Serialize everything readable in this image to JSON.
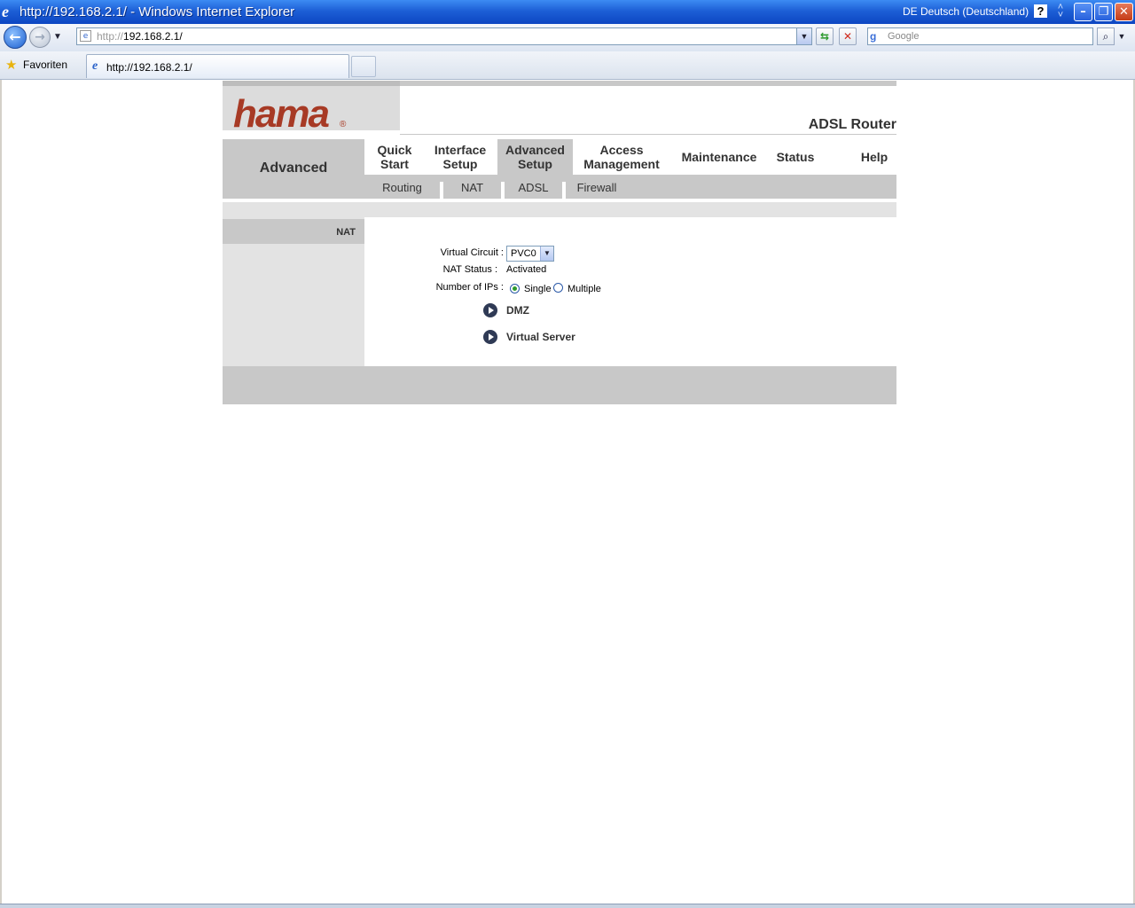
{
  "window": {
    "title": "http://192.168.2.1/ - Windows Internet Explorer",
    "language": "DE Deutsch (Deutschland)",
    "help": "?",
    "minimize": "–",
    "restore": "❐",
    "close": "✕"
  },
  "navigation": {
    "address_prefix": "http://",
    "address_host": "192.168.2.1/",
    "search_placeholder": "Google"
  },
  "favorites": {
    "label": "Favoriten",
    "tab_title": "http://192.168.2.1/"
  },
  "router": {
    "logo": "hama",
    "logo_mark": "®",
    "product": "ADSL Router",
    "section": "Advanced",
    "main_nav": [
      {
        "line1": "Quick",
        "line2": "Start"
      },
      {
        "line1": "Interface",
        "line2": "Setup"
      },
      {
        "line1": "Advanced",
        "line2": "Setup"
      },
      {
        "line1": "Access",
        "line2": "Management"
      },
      {
        "line1": "Maintenance",
        "line2": ""
      },
      {
        "line1": "Status",
        "line2": ""
      },
      {
        "line1": "Help",
        "line2": ""
      }
    ],
    "active_main": "Advanced Setup",
    "sub_nav": [
      "Routing",
      "NAT",
      "ADSL",
      "Firewall"
    ],
    "side_label": "NAT",
    "form": {
      "virtual_circuit_label": "Virtual Circuit :",
      "virtual_circuit_value": "PVC0",
      "nat_status_label": "NAT Status :",
      "nat_status_value": "Activated",
      "num_ips_label": "Number of IPs :",
      "num_ips_options": [
        "Single",
        "Multiple"
      ],
      "num_ips_selected": "Single",
      "links": [
        "DMZ",
        "Virtual Server"
      ]
    }
  },
  "colors": {
    "logo": "#a73a25",
    "panel_gray": "#c8c8c8",
    "panel_light": "#e3e3e3",
    "titlebar_blue": "#1d5fd6"
  }
}
